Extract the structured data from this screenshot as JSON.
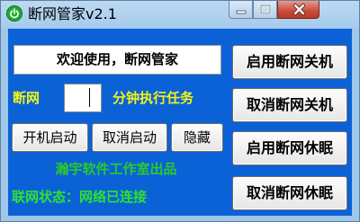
{
  "window": {
    "title": "断网管家v2.1"
  },
  "titlebar": {
    "app_icon": "power-icon",
    "minimize_icon": "minimize-icon",
    "maximize_icon": "maximize-icon",
    "close_icon": "close-icon"
  },
  "main": {
    "welcome_text": "欢迎使用，断网管家",
    "timer": {
      "prefix_label": "断网",
      "minutes_value": "",
      "suffix_label": "分钟执行任务"
    },
    "buttons": {
      "startup_enable": "开机启动",
      "startup_cancel": "取消启动",
      "hide": "隐藏"
    },
    "credit": "瀚宇软件工作室出品",
    "status": {
      "label": "联网状态：",
      "value": "网络已连接"
    }
  },
  "actions": {
    "enable_shutdown": "启用断网关机",
    "cancel_shutdown": "取消断网关机",
    "enable_sleep": "启用断网休眠",
    "cancel_sleep": "取消断网休眠"
  },
  "colors": {
    "client_background": "#0b62d6",
    "frame": "#9fc7ea",
    "label_yellow": "#f2f21a",
    "status_green": "#2fe02f",
    "close_button": "#c84a38"
  }
}
